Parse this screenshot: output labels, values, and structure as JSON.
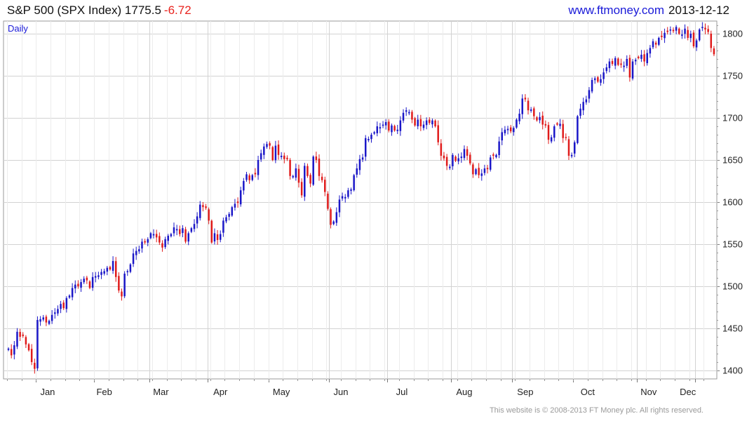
{
  "header": {
    "symbol": "S&P 500 (SPX Index)",
    "last": "1775.5",
    "change": "-6.72",
    "site": "www.ftmoney.com",
    "date": "2013-12-12"
  },
  "footer": "This website is © 2008-2013 FT Money plc. All rights reserved.",
  "colors": {
    "up": "#1a16c8",
    "down": "#e01a1a",
    "grid": "#d2d2d2",
    "label": "#1a1ad8"
  },
  "chart_data": {
    "type": "candlestick",
    "period_label": "Daily",
    "x_tick_labels": [
      "Jan",
      "Feb",
      "Mar",
      "Apr",
      "May",
      "Jun",
      "Jul",
      "Aug",
      "Sep",
      "Oct",
      "Nov",
      "Dec"
    ],
    "y_ticks": [
      1400,
      1450,
      1500,
      1550,
      1600,
      1650,
      1700,
      1750,
      1800
    ],
    "ylim": [
      1390,
      1815
    ],
    "grid": true,
    "y_axis_side": "right",
    "closes": [
      1426,
      1418,
      1430,
      1446,
      1440,
      1441,
      1431,
      1424,
      1410,
      1402,
      1460,
      1461,
      1463,
      1457,
      1459,
      1466,
      1469,
      1473,
      1479,
      1474,
      1486,
      1489,
      1498,
      1502,
      1500,
      1505,
      1509,
      1507,
      1498,
      1511,
      1512,
      1513,
      1517,
      1518,
      1522,
      1520,
      1530,
      1511,
      1495,
      1488,
      1515,
      1518,
      1526,
      1539,
      1542,
      1544,
      1553,
      1552,
      1556,
      1563,
      1562,
      1558,
      1552,
      1546,
      1556,
      1560,
      1562,
      1570,
      1568,
      1562,
      1569,
      1553,
      1563,
      1569,
      1574,
      1583,
      1597,
      1594,
      1593,
      1578,
      1552,
      1563,
      1555,
      1562,
      1578,
      1582,
      1586,
      1594,
      1598,
      1599,
      1614,
      1625,
      1633,
      1626,
      1632,
      1633,
      1650,
      1658,
      1666,
      1669,
      1667,
      1650,
      1667,
      1656,
      1655,
      1651,
      1651,
      1631,
      1631,
      1640,
      1623,
      1608,
      1643,
      1631,
      1622,
      1654,
      1650,
      1631,
      1626,
      1612,
      1592,
      1573,
      1577,
      1588,
      1603,
      1607,
      1606,
      1614,
      1615,
      1632,
      1640,
      1651,
      1653,
      1676,
      1675,
      1680,
      1683,
      1690,
      1689,
      1692,
      1695,
      1685,
      1691,
      1685,
      1686,
      1697,
      1706,
      1709,
      1707,
      1698,
      1691,
      1698,
      1690,
      1692,
      1697,
      1694,
      1697,
      1690,
      1671,
      1655,
      1652,
      1643,
      1642,
      1656,
      1649,
      1652,
      1654,
      1663,
      1655,
      1646,
      1633,
      1639,
      1632,
      1634,
      1640,
      1639,
      1653,
      1655,
      1656,
      1672,
      1683,
      1686,
      1687,
      1684,
      1688,
      1698,
      1705,
      1723,
      1722,
      1709,
      1710,
      1702,
      1697,
      1701,
      1692,
      1691,
      1674,
      1677,
      1690,
      1692,
      1693,
      1676,
      1676,
      1655,
      1656,
      1671,
      1702,
      1711,
      1719,
      1722,
      1733,
      1745,
      1747,
      1743,
      1746,
      1754,
      1760,
      1767,
      1764,
      1771,
      1763,
      1763,
      1762,
      1770,
      1748,
      1767,
      1769,
      1771,
      1775,
      1767,
      1777,
      1783,
      1791,
      1787,
      1795,
      1796,
      1801,
      1802,
      1805,
      1803,
      1808,
      1800,
      1799,
      1806,
      1795,
      1800,
      1785,
      1792,
      1805,
      1808,
      1805,
      1802,
      1783,
      1775.5
    ]
  }
}
